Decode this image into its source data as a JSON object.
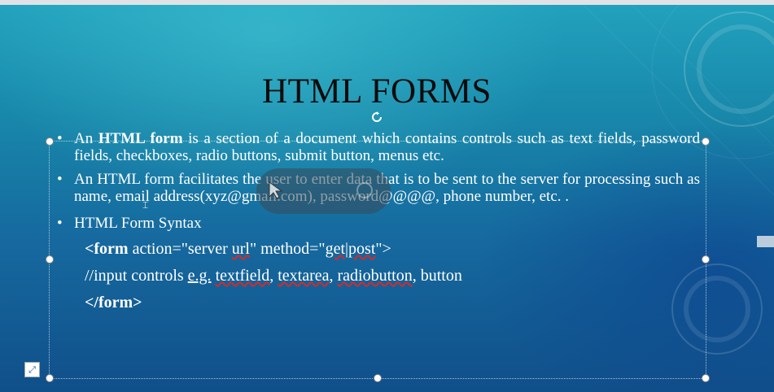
{
  "slide": {
    "title": "HTML FORMS",
    "bullets": {
      "b1": {
        "pre": "An ",
        "bold": "HTML form",
        "post": " is a section of a document which contains controls such as text fields, password fields, checkboxes, radio buttons, submit button, menus etc."
      },
      "b2": {
        "text": "An HTML form facilitates the user to enter data that is to be sent to the server for processing such as name, email address(xyz@gmail.com), password@@@@, phone number, etc. ."
      },
      "b3": {
        "text": "HTML Form Syntax"
      }
    },
    "code": {
      "line1_open": "<form",
      "line1_attr1": " action=\"server ",
      "line1_url": "url",
      "line1_attr2": "\" method=\"",
      "line1_get": "get|post",
      "line1_close": "\">",
      "line2_pre": "//input controls ",
      "line2_eg": "e.g.",
      "line2_sp1": " ",
      "line2_textfield": "textfield",
      "line2_sep1": ", ",
      "line2_textarea": "textarea",
      "line2_sep2": ", ",
      "line2_radiobutton": "radiobutton",
      "line2_end": ", button",
      "line3": "</form>"
    },
    "bullet_glyph": "•"
  },
  "icons": {
    "rotate_handle": "rotate-icon",
    "layout_options": "layout-options-icon",
    "cursor": "pointer-icon"
  },
  "colors": {
    "title": "#0c0c0c",
    "body_text": "#ffffff",
    "background_top": "#22a2bd",
    "background_bottom": "#104f8a"
  }
}
